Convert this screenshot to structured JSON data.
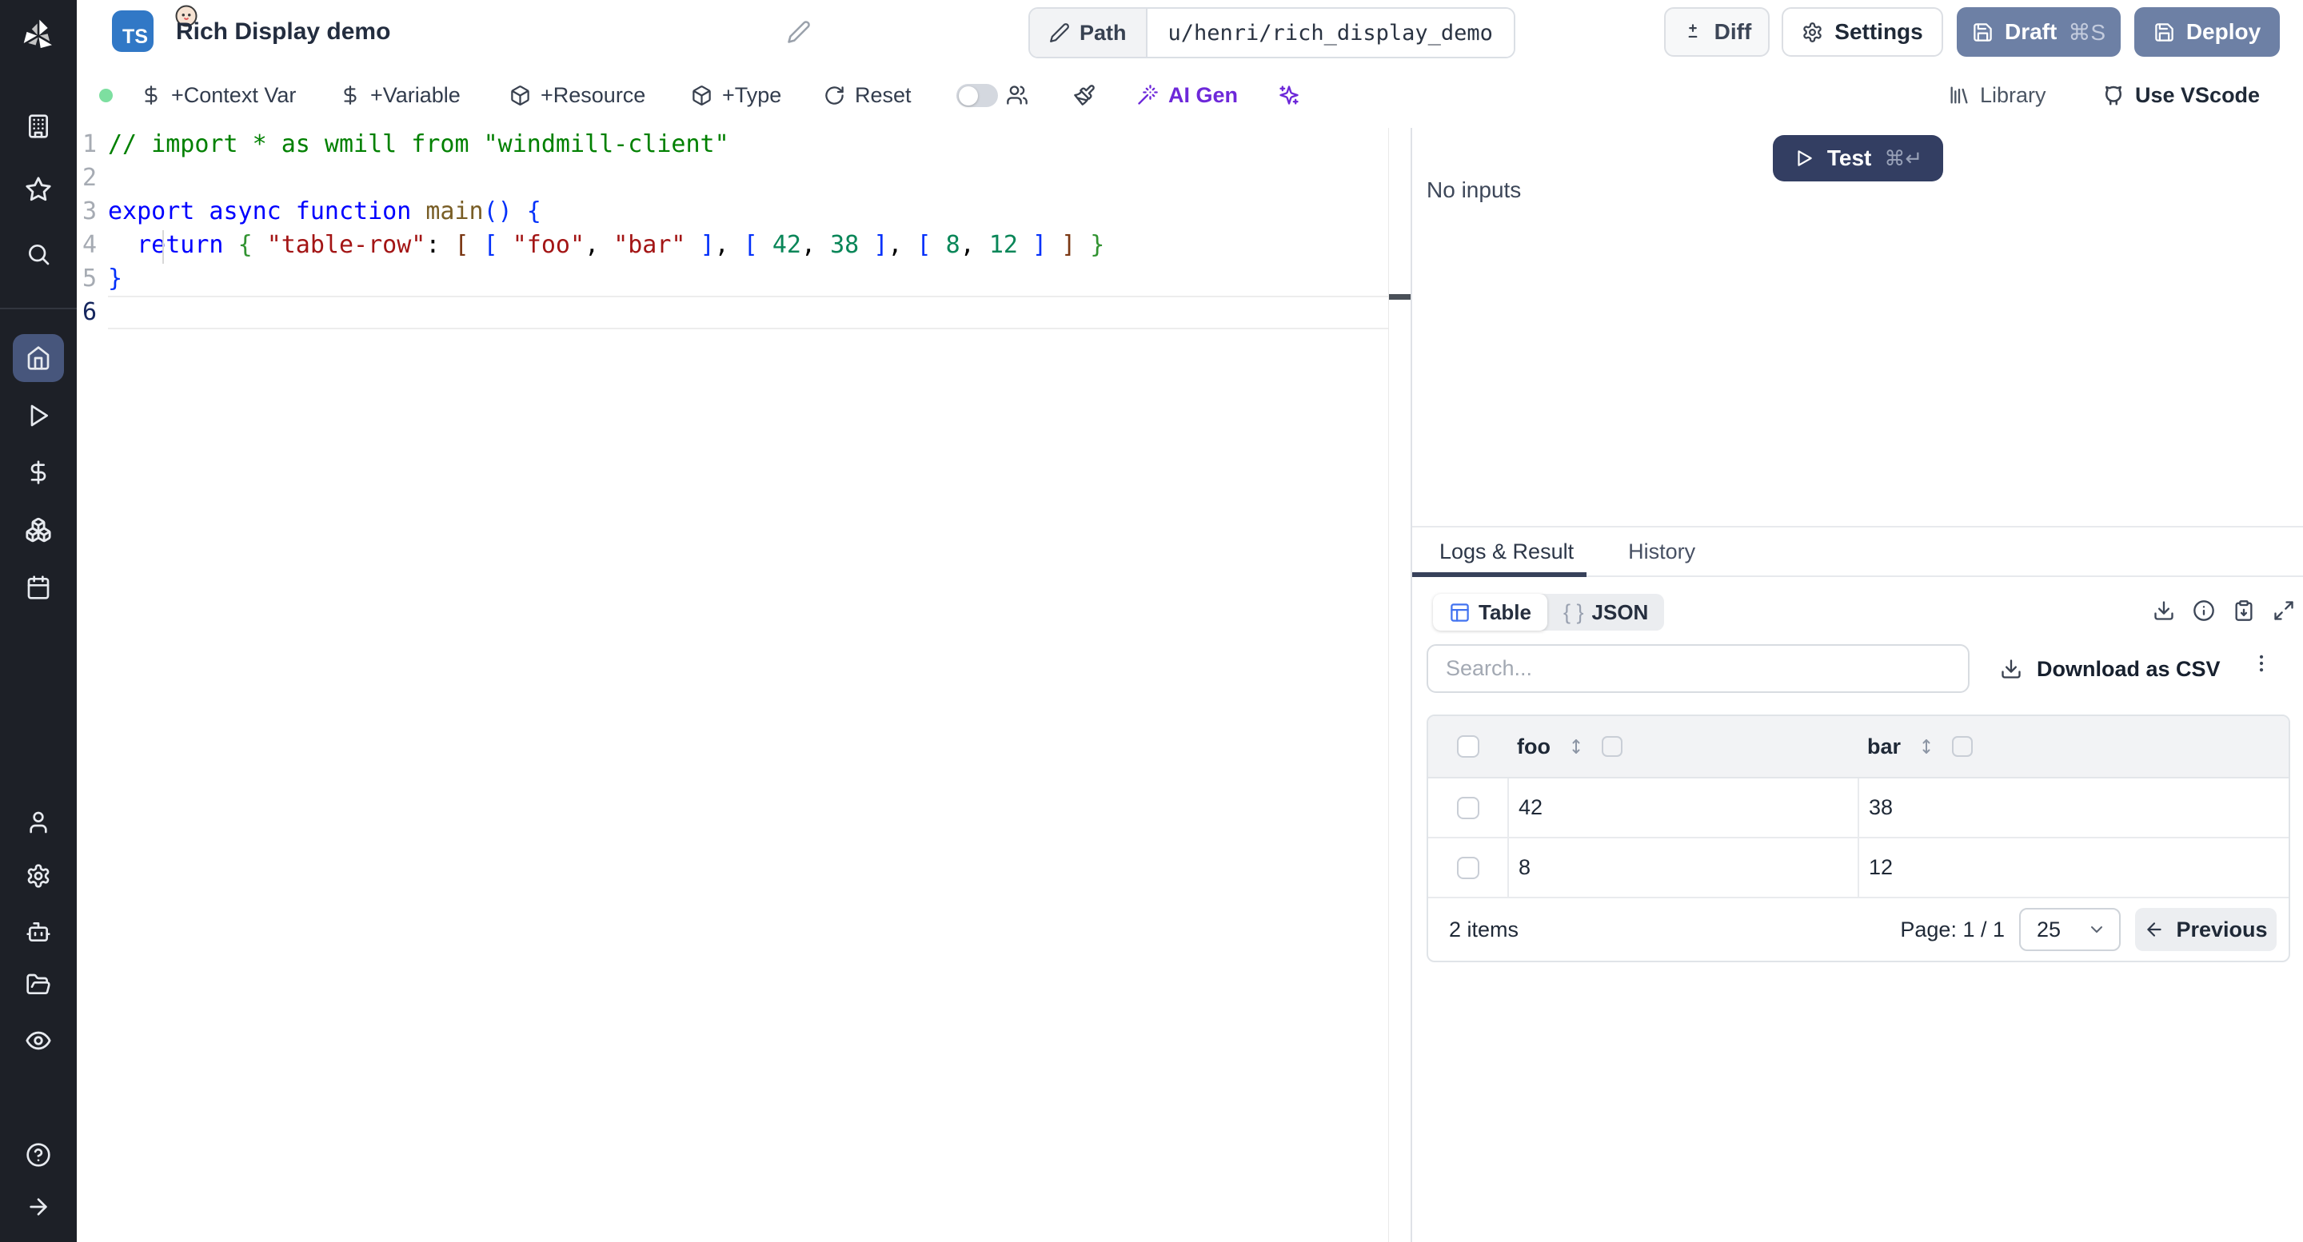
{
  "header": {
    "language_badge": "TS",
    "title": "Rich Display demo",
    "path": {
      "label": "Path",
      "value": "u/henri/rich_display_demo"
    },
    "buttons": {
      "diff": "Diff",
      "settings": "Settings",
      "draft": "Draft",
      "draft_kbd": "⌘S",
      "deploy": "Deploy"
    }
  },
  "toolbar": {
    "context_var": "+Context Var",
    "variable": "+Variable",
    "resource": "+Resource",
    "type": "+Type",
    "reset": "Reset",
    "ai_gen": "AI Gen",
    "library": "Library",
    "use_vscode": "Use VScode"
  },
  "sidebar": {
    "active": "home",
    "items": [
      "workspace",
      "favorites",
      "search",
      "home",
      "runs",
      "variables",
      "resources",
      "schedules",
      "users",
      "settings",
      "workers",
      "folders",
      "audit",
      "help",
      "expand"
    ]
  },
  "editor": {
    "lines": [
      {
        "n": "1",
        "active": false,
        "tokens": [
          [
            "c",
            "// import * as wmill from \"windmill-client\""
          ]
        ]
      },
      {
        "n": "2",
        "active": false,
        "tokens": []
      },
      {
        "n": "3",
        "active": false,
        "tokens": [
          [
            "k",
            "export async function"
          ],
          [
            "fn",
            " main"
          ],
          [
            "b1",
            "()"
          ],
          [
            "p",
            " "
          ],
          [
            "b1",
            "{"
          ]
        ]
      },
      {
        "n": "4",
        "active": false,
        "tokens": [
          [
            "p",
            "  "
          ],
          [
            "k",
            "return"
          ],
          [
            "p",
            " "
          ],
          [
            "b2",
            "{"
          ],
          [
            "p",
            " "
          ],
          [
            "s",
            "\"table-row\""
          ],
          [
            "p",
            ": "
          ],
          [
            "b3",
            "["
          ],
          [
            "p",
            " "
          ],
          [
            "b1",
            "["
          ],
          [
            "p",
            " "
          ],
          [
            "s",
            "\"foo\""
          ],
          [
            "p",
            ", "
          ],
          [
            "s",
            "\"bar\""
          ],
          [
            "p",
            " "
          ],
          [
            "b1",
            "]"
          ],
          [
            "p",
            ", "
          ],
          [
            "b1",
            "["
          ],
          [
            "p",
            " "
          ],
          [
            "n",
            "42"
          ],
          [
            "p",
            ", "
          ],
          [
            "n",
            "38"
          ],
          [
            "p",
            " "
          ],
          [
            "b1",
            "]"
          ],
          [
            "p",
            ", "
          ],
          [
            "b1",
            "["
          ],
          [
            "p",
            " "
          ],
          [
            "n",
            "8"
          ],
          [
            "p",
            ", "
          ],
          [
            "n",
            "12"
          ],
          [
            "p",
            " "
          ],
          [
            "b1",
            "]"
          ],
          [
            "p",
            " "
          ],
          [
            "b3",
            "]"
          ],
          [
            "p",
            " "
          ],
          [
            "b2",
            "}"
          ]
        ]
      },
      {
        "n": "5",
        "active": false,
        "tokens": [
          [
            "b1",
            "}"
          ]
        ]
      },
      {
        "n": "6",
        "active": true,
        "tokens": []
      }
    ]
  },
  "run": {
    "test": "Test",
    "test_kbd": "⌘↵",
    "no_inputs": "No inputs"
  },
  "result": {
    "tabs": {
      "logs": "Logs & Result",
      "history": "History"
    },
    "views": {
      "table": "Table",
      "json_braces": "{ }",
      "json": "JSON"
    },
    "search_placeholder": "Search...",
    "download_csv": "Download as CSV",
    "table": {
      "columns": [
        "foo",
        "bar"
      ],
      "rows": [
        [
          "42",
          "38"
        ],
        [
          "8",
          "12"
        ]
      ],
      "items_label": "2 items",
      "page_label": "Page: 1 / 1",
      "page_size": "25",
      "previous": "Previous"
    }
  }
}
